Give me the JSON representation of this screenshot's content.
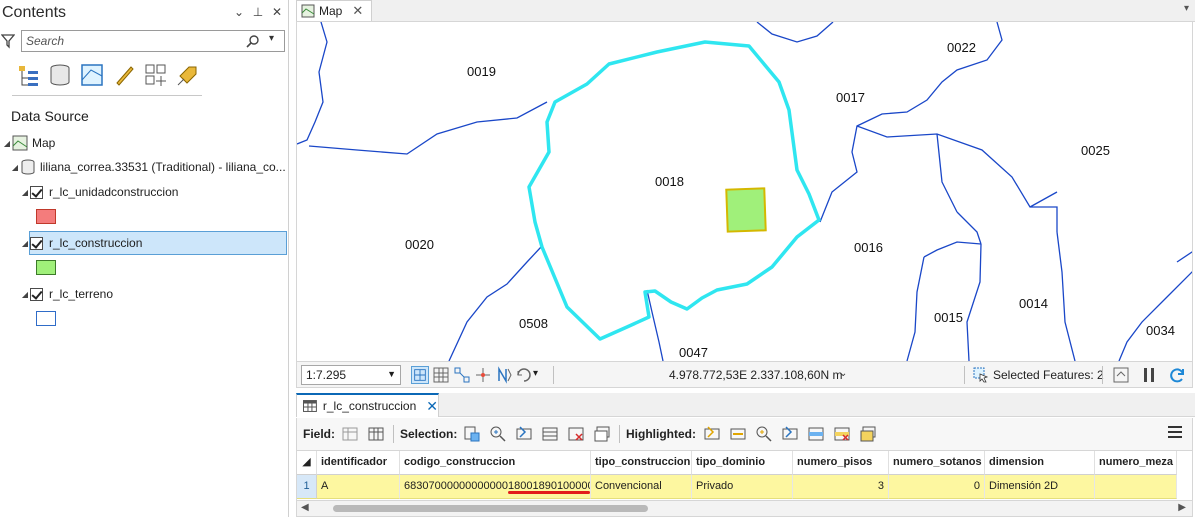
{
  "contents": {
    "title": "Contents",
    "search_placeholder": "Search",
    "data_source_heading": "Data Source",
    "tree": {
      "map": "Map",
      "database": "liliana_correa.33531 (Traditional) - liliana_co...",
      "layers": [
        {
          "name": "r_lc_unidadconstruccion",
          "swatch_fill": "#f47c7c",
          "swatch_stroke": "#c0392b",
          "checked": true,
          "selected": false
        },
        {
          "name": "r_lc_construccion",
          "swatch_fill": "#a0f07a",
          "swatch_stroke": "#3d7a2a",
          "checked": true,
          "selected": true
        },
        {
          "name": "r_lc_terreno",
          "swatch_fill": "#ffffff",
          "swatch_stroke": "#2f6cc8",
          "checked": true,
          "selected": false
        }
      ]
    }
  },
  "map_view": {
    "tab_label": "Map",
    "parcel_labels": [
      "0019",
      "0022",
      "0017",
      "0025",
      "0018",
      "0020",
      "0016",
      "0014",
      "0015",
      "0508",
      "0047",
      "0034"
    ],
    "colors": {
      "boundary": "#1a47c8",
      "highlight": "#2fe6f0",
      "building_fill": "#a0f07a",
      "building_stroke": "#d4b800"
    }
  },
  "status_bar": {
    "scale": "1:7.295",
    "coordinates": "4.978.772,53E 2.337.108,60N m",
    "selected_features": "Selected Features: 2"
  },
  "attribute_table": {
    "tab_label": "r_lc_construccion",
    "toolbar": {
      "field": "Field:",
      "selection": "Selection:",
      "highlighted": "Highlighted:"
    },
    "columns": [
      "identificador",
      "codigo_construccion",
      "tipo_construccion",
      "tipo_dominio",
      "numero_pisos",
      "numero_sotanos",
      "dimension",
      "numero_meza"
    ],
    "rows": [
      {
        "rownum": "1",
        "cells": [
          "A",
          "68307000000000000180018901000000",
          "Convencional",
          "Privado",
          "3",
          "0",
          "Dimensión 2D",
          ""
        ]
      }
    ]
  }
}
